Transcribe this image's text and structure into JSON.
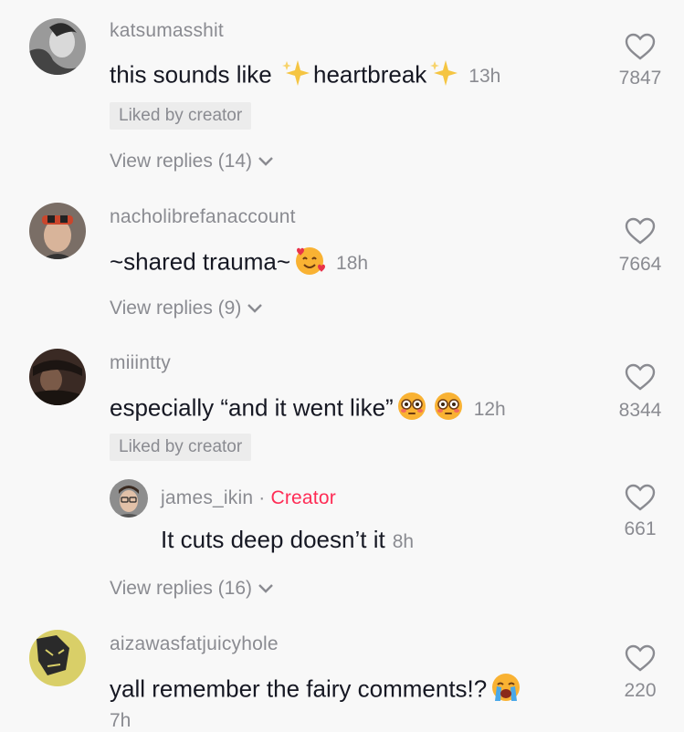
{
  "comments": [
    {
      "username": "katsumasshit",
      "text_before": "this sounds like ",
      "text_mid": "heartbreak",
      "time": "13h",
      "liked_label": "Liked by creator",
      "replies_label": "View replies (14)",
      "likes": "7847"
    },
    {
      "username": "nacholibrefanaccount",
      "text": "~shared trauma~",
      "time": "18h",
      "replies_label": "View replies (9)",
      "likes": "7664"
    },
    {
      "username": "miiintty",
      "text": "especially “and it went like”",
      "time": "12h",
      "liked_label": "Liked by creator",
      "likes": "8344"
    },
    {
      "username": "aizawasfatjuicyhole",
      "text": "yall remember the fairy comments!?",
      "time": "7h",
      "likes": "220"
    }
  ],
  "reply": {
    "username": "james_ikin",
    "separator": " · ",
    "creator_label": "Creator",
    "text": "It cuts deep doesn’t it",
    "time": "8h",
    "likes": "661",
    "replies_label": "View replies (16)"
  },
  "icons": {
    "heart": "heart-outline-icon",
    "chevron": "chevron-down-icon",
    "sparkles": "sparkles-emoji",
    "smiling_hearts": "smiling-face-with-hearts-emoji",
    "flushed": "flushed-face-emoji",
    "crying": "loudly-crying-face-emoji"
  },
  "colors": {
    "background": "#f8f8f8",
    "text": "#161823",
    "secondary": "#8a8b91",
    "creator": "#fe2c55"
  }
}
